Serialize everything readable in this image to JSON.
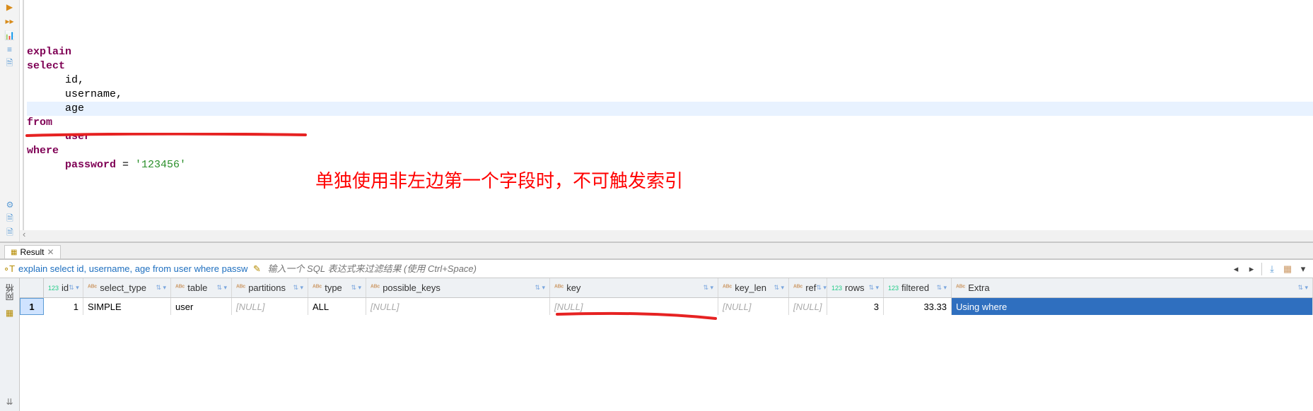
{
  "editor": {
    "lines": [
      {
        "indent": 0,
        "tokens": [
          {
            "t": "kw",
            "v": "explain"
          }
        ]
      },
      {
        "indent": 0,
        "tokens": [
          {
            "t": "kw",
            "v": "select"
          }
        ]
      },
      {
        "indent": 2,
        "tokens": [
          {
            "t": "ident",
            "v": "id,"
          }
        ]
      },
      {
        "indent": 2,
        "tokens": [
          {
            "t": "ident",
            "v": "username,"
          }
        ]
      },
      {
        "indent": 2,
        "hl": true,
        "tokens": [
          {
            "t": "ident",
            "v": "age"
          }
        ]
      },
      {
        "indent": 0,
        "tokens": [
          {
            "t": "kw",
            "v": "from"
          }
        ]
      },
      {
        "indent": 2,
        "tokens": [
          {
            "t": "kw",
            "v": "user"
          }
        ]
      },
      {
        "indent": 0,
        "tokens": [
          {
            "t": "kw",
            "v": "where"
          }
        ]
      },
      {
        "indent": 2,
        "tokens": [
          {
            "t": "kw",
            "v": "password"
          },
          {
            "t": "ident",
            "v": " = "
          },
          {
            "t": "str",
            "v": "'123456'"
          }
        ]
      }
    ],
    "annotation": "单独使用非左边第一个字段时，不可触发索引"
  },
  "result_tab": {
    "label": "Result"
  },
  "filter": {
    "sql_preview": "explain select id, username, age from user where passw",
    "placeholder": "输入一个 SQL 表达式来过滤结果 (使用 Ctrl+Space)"
  },
  "grid": {
    "side_label": "网格",
    "columns": [
      {
        "key": "id",
        "label": "id",
        "icon": "123",
        "cls": "c-id",
        "align": "right"
      },
      {
        "key": "select_type",
        "label": "select_type",
        "icon": "ABC",
        "cls": "c-seltype"
      },
      {
        "key": "table",
        "label": "table",
        "icon": "ABC",
        "cls": "c-table"
      },
      {
        "key": "partitions",
        "label": "partitions",
        "icon": "ABC",
        "cls": "c-part"
      },
      {
        "key": "type",
        "label": "type",
        "icon": "ABC",
        "cls": "c-type"
      },
      {
        "key": "possible_keys",
        "label": "possible_keys",
        "icon": "ABC",
        "cls": "c-posskey"
      },
      {
        "key": "key",
        "label": "key",
        "icon": "ABC",
        "cls": "c-key"
      },
      {
        "key": "key_len",
        "label": "key_len",
        "icon": "ABC",
        "cls": "c-keylen"
      },
      {
        "key": "ref",
        "label": "ref",
        "icon": "ABC",
        "cls": "c-ref"
      },
      {
        "key": "rows",
        "label": "rows",
        "icon": "123",
        "cls": "c-rows",
        "align": "right"
      },
      {
        "key": "filtered",
        "label": "filtered",
        "icon": "123",
        "cls": "c-filtered",
        "align": "right"
      },
      {
        "key": "Extra",
        "label": "Extra",
        "icon": "ABC",
        "cls": "c-extra-h"
      }
    ],
    "rows": [
      {
        "id": "1",
        "select_type": "SIMPLE",
        "table": "user",
        "partitions": null,
        "type": "ALL",
        "possible_keys": null,
        "key": null,
        "key_len": null,
        "ref": null,
        "rows": "3",
        "filtered": "33.33",
        "Extra": "Using where"
      }
    ],
    "null_text": "[NULL]"
  }
}
